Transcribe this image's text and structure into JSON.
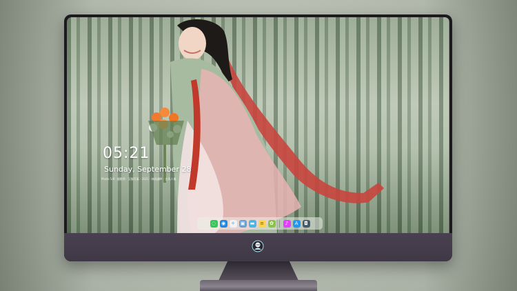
{
  "lock_screen": {
    "time": "05:21",
    "date": "Sunday, September 28",
    "caption": "Photo 5/8 · 摄影师 · 汉服写真 · 2021 · 林间湖畔 · 古风人像"
  },
  "dock": {
    "apps": [
      {
        "name": "messages-icon",
        "color": "#34c759",
        "glyph": "◌"
      },
      {
        "name": "finder-icon",
        "color": "#1e88e5",
        "glyph": "◉"
      },
      {
        "name": "safari-icon",
        "color": "#f2f2f2",
        "glyph": "✧"
      },
      {
        "name": "preview-icon",
        "color": "#6aa0d8",
        "glyph": "▣"
      },
      {
        "name": "folder-icon",
        "color": "#4fb3e8",
        "glyph": "▬"
      },
      {
        "name": "notes-icon",
        "color": "#ffd54f",
        "glyph": "≡"
      },
      {
        "name": "photos-icon",
        "color": "#8bc34a",
        "glyph": "✿"
      },
      {
        "name": "music-icon",
        "color": "#e040fb",
        "glyph": "♪"
      },
      {
        "name": "app-store-icon",
        "color": "#2196f3",
        "glyph": "A"
      },
      {
        "name": "camera-icon",
        "color": "#455a64",
        "glyph": "◘"
      }
    ]
  },
  "colors": {
    "monitor_bezel": "#1c1a1e",
    "monitor_chin": "#4a4150",
    "backdrop": "#b5bcae"
  }
}
